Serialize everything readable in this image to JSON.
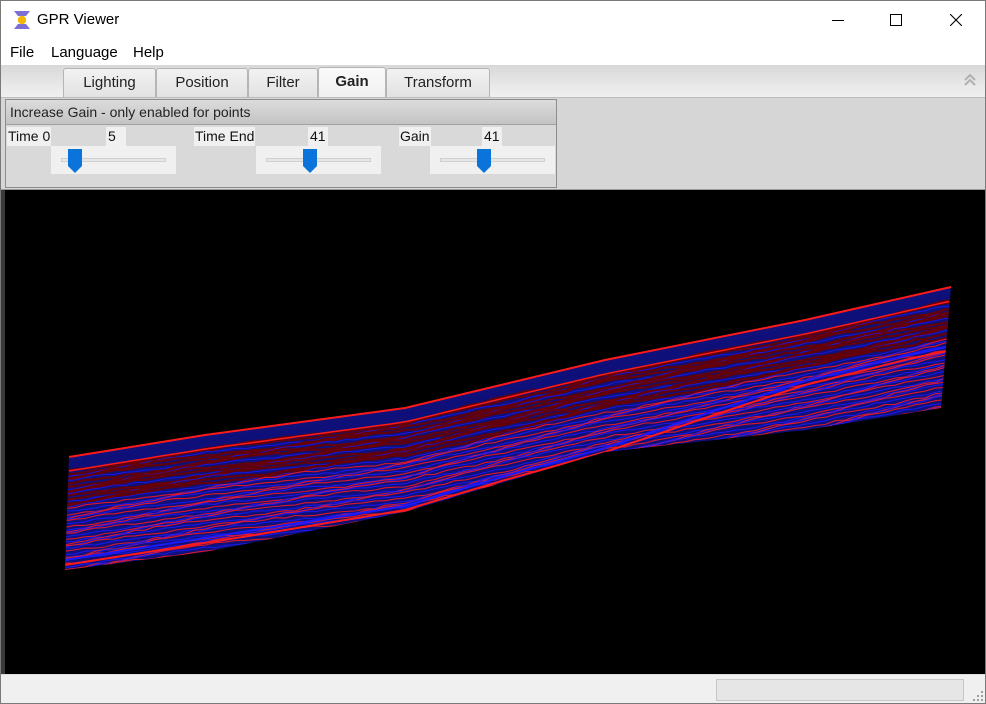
{
  "window": {
    "title": "GPR Viewer",
    "app_icon": "hourglass-sun-icon",
    "controls": [
      "minimize-icon",
      "maximize-icon",
      "close-icon"
    ]
  },
  "menu": {
    "items": [
      {
        "label": "File"
      },
      {
        "label": "Language"
      },
      {
        "label": "Help"
      }
    ]
  },
  "tabs": {
    "items": [
      {
        "label": "Lighting",
        "active": false
      },
      {
        "label": "Position",
        "active": false
      },
      {
        "label": "Filter",
        "active": false
      },
      {
        "label": "Gain",
        "active": true
      },
      {
        "label": "Transform",
        "active": false
      }
    ],
    "collapse_icon": "double-chevron-up-icon"
  },
  "gain_panel": {
    "title": "Increase Gain -  only enabled for points",
    "sliders": [
      {
        "label": "Time 0",
        "value": "5",
        "fraction": 0.13
      },
      {
        "label": "Time End",
        "value": "41",
        "fraction": 0.42
      },
      {
        "label": "Gain",
        "value": "41",
        "fraction": 0.42
      }
    ]
  },
  "viewport": {
    "description": "3D GPR radargram rendered as red/blue point layers on black background",
    "background": "#000000",
    "colors": {
      "positive": "#ff1a1a",
      "negative": "#1a1aff",
      "dark_red": "#6a0000",
      "dark_blue": "#10107a"
    }
  },
  "statusbar": {
    "text": "",
    "progress": 0
  },
  "colors": {
    "slider_thumb": "#0a74da",
    "chrome_bg": "#f0f0f0",
    "panel_bg": "#d6d6d6"
  }
}
